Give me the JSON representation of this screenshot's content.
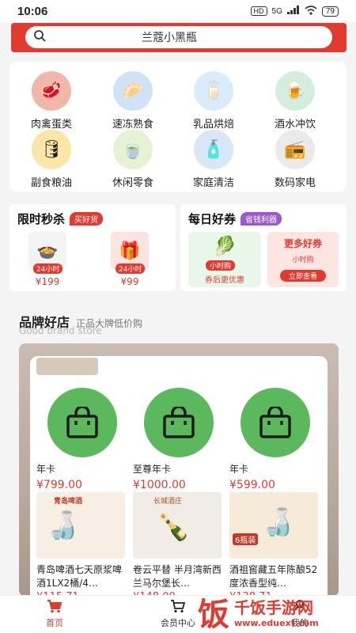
{
  "status_bar": {
    "time": "10:06",
    "hd": "HD",
    "network": "5G",
    "battery": "79"
  },
  "search": {
    "placeholder": "兰蔻小黑瓶"
  },
  "categories": [
    {
      "label": "肉禽蛋类",
      "icon": "meat-icon",
      "color": "#f1b7a8",
      "glyph": "🥩"
    },
    {
      "label": "速冻熟食",
      "icon": "frozen-food-icon",
      "color": "#cfe3f7",
      "glyph": "🥟"
    },
    {
      "label": "乳品烘焙",
      "icon": "dairy-icon",
      "color": "#d9ecf9",
      "glyph": "🥛"
    },
    {
      "label": "酒水冲饮",
      "icon": "drinks-icon",
      "color": "#d3eedd",
      "glyph": "🍺"
    },
    {
      "label": "副食粮油",
      "icon": "oil-icon",
      "color": "#fbe6a8",
      "glyph": "🛢"
    },
    {
      "label": "休闲零食",
      "icon": "snack-icon",
      "color": "#e6f2d4",
      "glyph": "🍵"
    },
    {
      "label": "家庭清洁",
      "icon": "cleaning-icon",
      "color": "#d7e7f7",
      "glyph": "🧴"
    },
    {
      "label": "数码家电",
      "icon": "appliance-icon",
      "color": "#eaeaea",
      "glyph": "📻"
    }
  ],
  "flash_sale": {
    "title": "限时秒杀",
    "tag": "买好货",
    "items": [
      {
        "badge": "24小时",
        "price": "¥199"
      },
      {
        "badge": "24小时",
        "price": "¥99"
      }
    ]
  },
  "daily_coupon": {
    "title": "每日好券",
    "tag": "省钱利器",
    "left": {
      "badge": "小时购",
      "caption": "券后更优惠"
    },
    "right": {
      "label": "更多好券",
      "badge": "小时购",
      "button": "立即查看"
    }
  },
  "brand_section": {
    "title": "品牌好店",
    "subtitle": "正品大牌低价购",
    "subtitle_en": "Good brand store",
    "cards": [
      {
        "name": "年卡",
        "price": "¥799.00"
      },
      {
        "name": "至尊年卡",
        "price": "¥1000.00"
      },
      {
        "name": "年卡",
        "price": "¥599.00"
      }
    ],
    "products": [
      {
        "name": "青岛啤酒七天原浆啤酒1LX2桶/4…",
        "price": "¥115.71",
        "banner": "青岛啤酒"
      },
      {
        "name": "卷云平替 半月湾新西兰马尔堡长…",
        "price": "¥148.00",
        "banner": "长城酒庄"
      },
      {
        "name": "酒祖窖藏五年陈酿52度浓香型纯…",
        "price": "¥138.71",
        "banner": "6瓶装"
      }
    ]
  },
  "tabbar": {
    "tabs": [
      {
        "label": "首页",
        "icon": "home-cart-icon"
      },
      {
        "label": "会员中心",
        "icon": "member-cart-icon"
      },
      {
        "label": "我的",
        "icon": "profile-icon"
      }
    ]
  },
  "watermark": {
    "glyph": "饭",
    "text": "千饭手游网",
    "url": "www.eduext.com"
  },
  "colors": {
    "accent": "#e23a2e",
    "green": "#5cb85c",
    "purple_tag": "#9b59d0"
  }
}
